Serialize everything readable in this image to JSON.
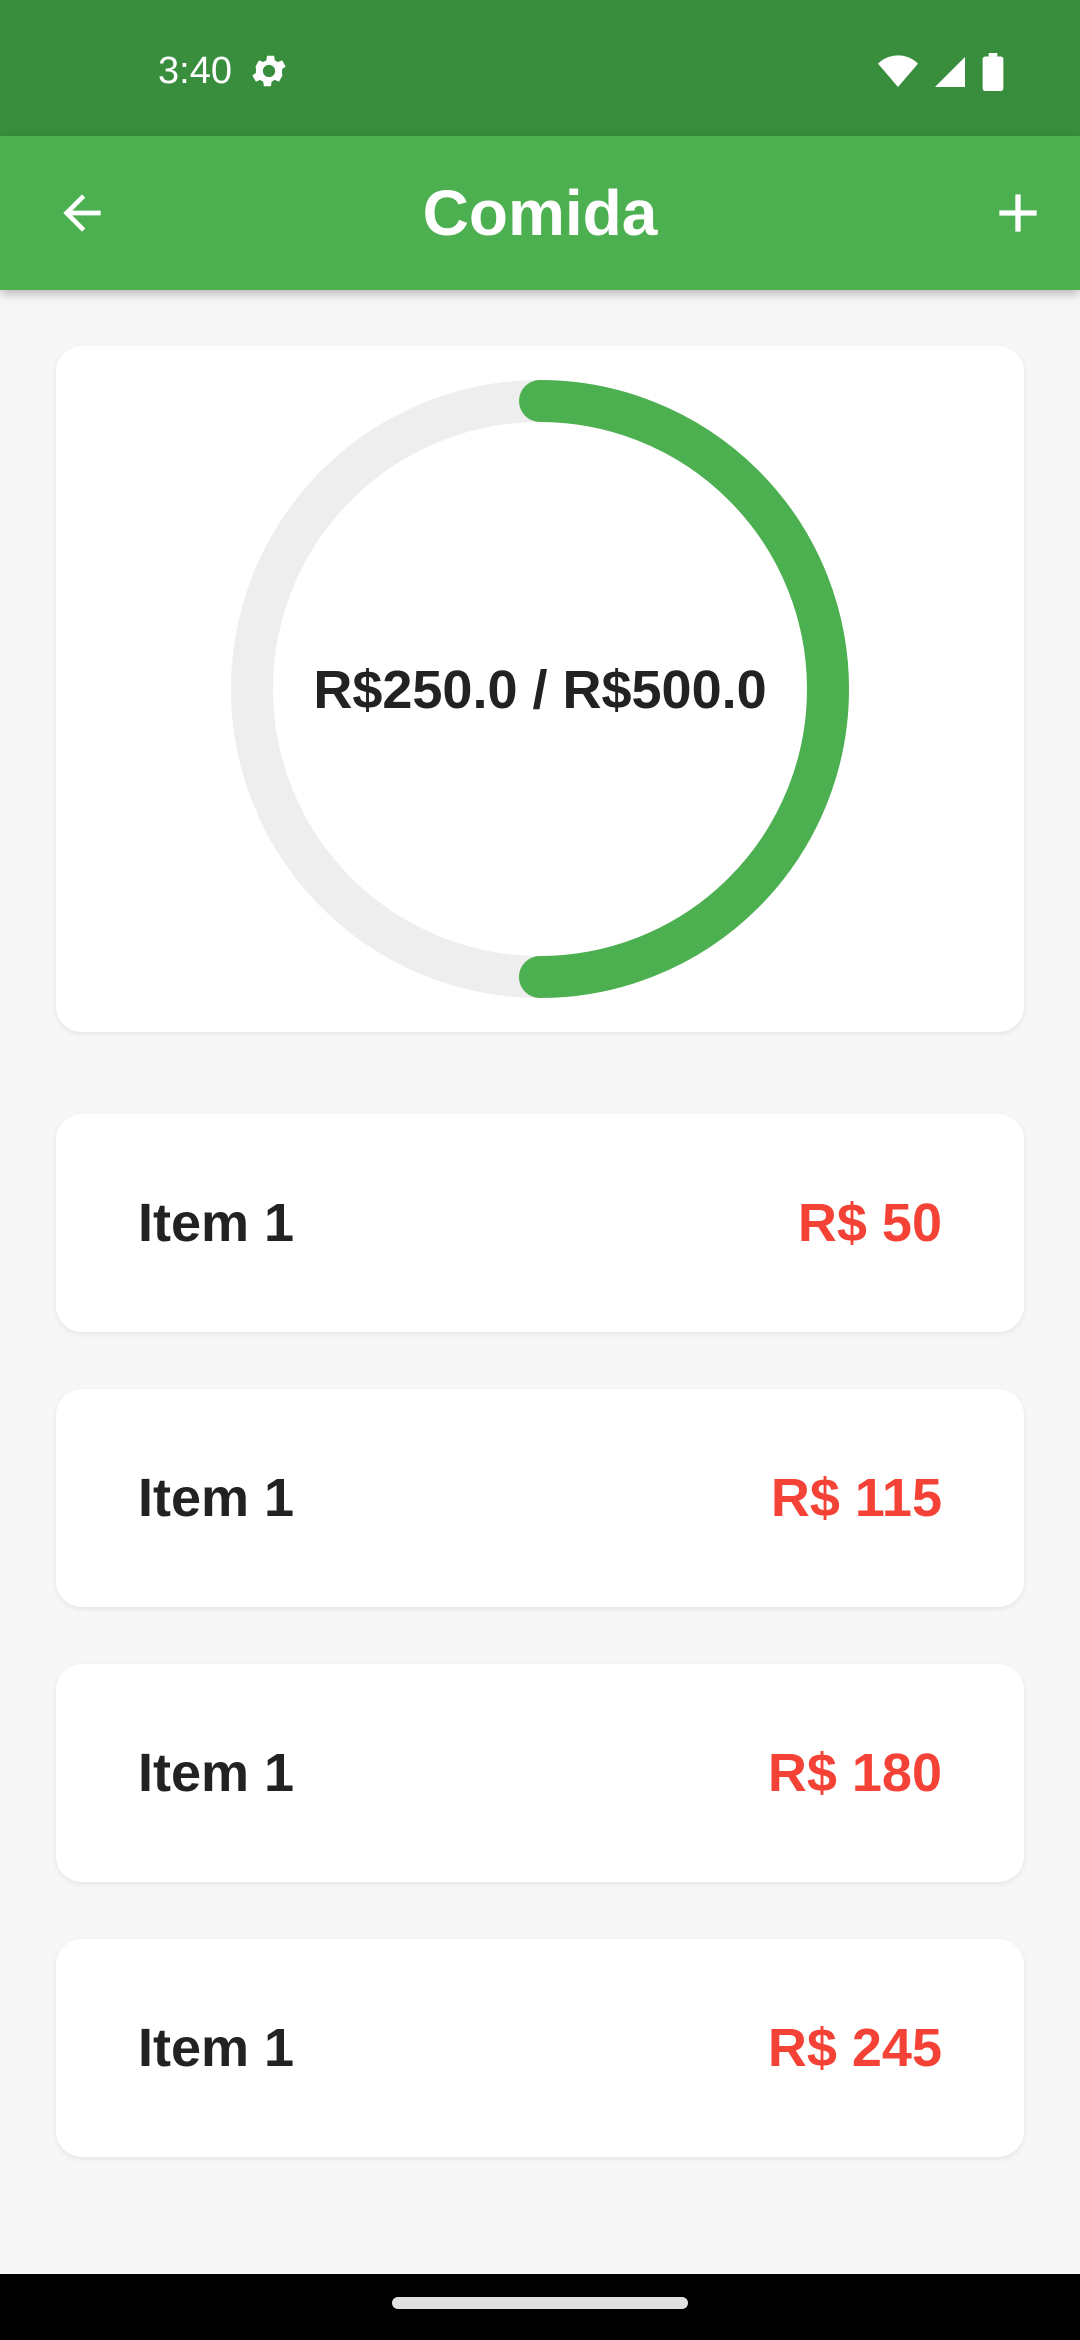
{
  "status_bar": {
    "time": "3:40"
  },
  "app_bar": {
    "title": "Comida"
  },
  "budget": {
    "label": "R$250.0 / R$500.0",
    "spent": 250.0,
    "total": 500.0,
    "progress_fraction": 0.5
  },
  "items": [
    {
      "name": "Item 1",
      "value": "R$ 50"
    },
    {
      "name": "Item 1",
      "value": "R$ 115"
    },
    {
      "name": "Item 1",
      "value": "R$ 180"
    },
    {
      "name": "Item 1",
      "value": "R$ 245"
    }
  ],
  "colors": {
    "status_bar": "#388e3c",
    "app_bar": "#4caf50",
    "progress": "#4caf50",
    "progress_track": "#eeeeee",
    "item_value": "#f44336"
  },
  "icons": {
    "back": "arrow-left-icon",
    "add": "plus-icon",
    "status_settings": "gear-icon",
    "wifi": "wifi-icon",
    "signal": "signal-icon",
    "battery": "battery-icon"
  }
}
